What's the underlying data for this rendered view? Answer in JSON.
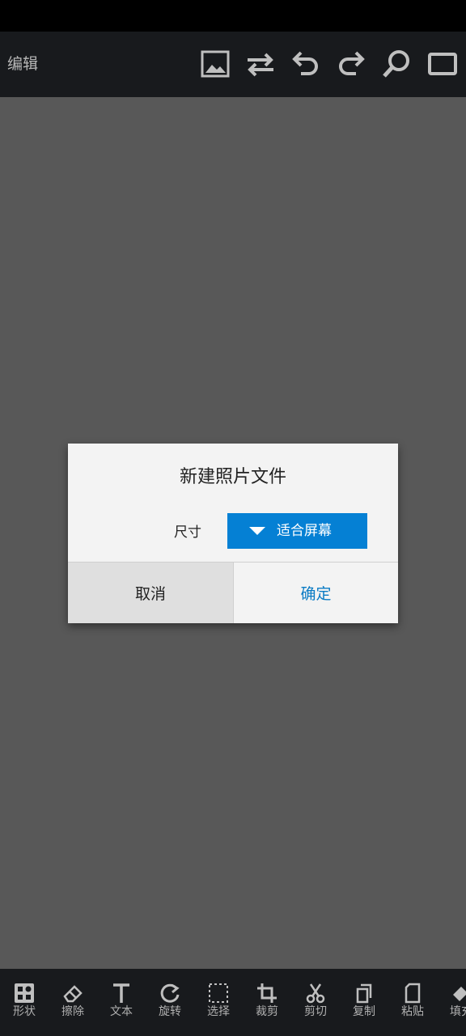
{
  "header": {
    "title": "编辑",
    "icons": [
      "image-icon",
      "swap-icon",
      "undo-icon",
      "redo-icon",
      "zoom-icon",
      "fullscreen-icon"
    ]
  },
  "dialog": {
    "title": "新建照片文件",
    "size_label": "尺寸",
    "size_value": "适合屏幕",
    "cancel_label": "取消",
    "ok_label": "确定",
    "accent_color": "#0580d4"
  },
  "toolbar": {
    "items": [
      {
        "label": "形状",
        "icon": "shapes-icon"
      },
      {
        "label": "擦除",
        "icon": "eraser-icon"
      },
      {
        "label": "文本",
        "icon": "text-icon"
      },
      {
        "label": "旋转",
        "icon": "rotate-icon"
      },
      {
        "label": "选择",
        "icon": "select-icon"
      },
      {
        "label": "裁剪",
        "icon": "crop-icon"
      },
      {
        "label": "剪切",
        "icon": "scissors-icon"
      },
      {
        "label": "复制",
        "icon": "copy-icon"
      },
      {
        "label": "粘贴",
        "icon": "paste-icon"
      },
      {
        "label": "填充",
        "icon": "fill-icon"
      }
    ]
  }
}
